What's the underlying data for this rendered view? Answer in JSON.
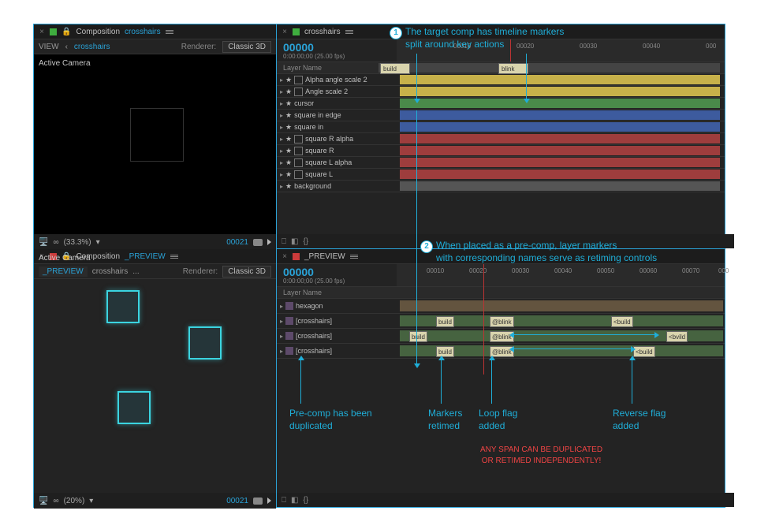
{
  "annotations": {
    "a1": "The target comp has timeline markers\nsplit around key actions",
    "a2": "When placed as a pre-comp, layer markers\nwith corresponding names serve as retiming controls",
    "b1": "Pre-comp has been\nduplicated",
    "b2": "Markers\nretimed",
    "b3": "Loop flag\nadded",
    "b4": "Reverse flag\nadded",
    "warn": "ANY SPAN CAN BE DUPLICATED\nOR RETIMED INDEPENDENTLY!"
  },
  "viewer1": {
    "compLabel": "Composition",
    "compName": "crosshairs",
    "navView": "VIEW",
    "navChevL": "‹",
    "active": "crosshairs",
    "renderer": "Renderer:",
    "rendermode": "Classic 3D",
    "activeCam": "Active Camera",
    "zoom": "(33.3%)",
    "frame": "00021"
  },
  "timeline1": {
    "name": "crosshairs",
    "tc": "00000",
    "tcsub": "0:00:00;00 (25.00 fps)",
    "layerNameHdr": "Layer Name",
    "ruler": [
      "00010",
      "00020",
      "00030",
      "00040",
      "000"
    ],
    "markers": {
      "build": "build",
      "blink": "blink"
    },
    "layers": [
      {
        "name": "Alpha angle scale 2",
        "color": "yl",
        "star": true,
        "box": true
      },
      {
        "name": "Angle scale 2",
        "color": "yl",
        "star": true,
        "box": true
      },
      {
        "name": "cursor",
        "color": "gn",
        "star": true,
        "box": false
      },
      {
        "name": "square in edge",
        "color": "bl",
        "star": true,
        "box": false
      },
      {
        "name": "square in",
        "color": "bl",
        "star": true,
        "box": false
      },
      {
        "name": "square R alpha",
        "color": "rd",
        "star": true,
        "box": true
      },
      {
        "name": "square R",
        "color": "rd",
        "star": true,
        "box": true
      },
      {
        "name": "square L alpha",
        "color": "rd",
        "star": true,
        "box": true
      },
      {
        "name": "square L",
        "color": "rd",
        "star": true,
        "box": true
      },
      {
        "name": "background",
        "color": "gy",
        "star": true,
        "box": false
      }
    ]
  },
  "viewer2": {
    "compLabel": "Composition",
    "compName": "_PREVIEW",
    "tabs": [
      "_PREVIEW",
      "crosshairs",
      "..."
    ],
    "renderer": "Renderer:",
    "rendermode": "Classic 3D",
    "activeCam": "Active Camera",
    "zoom": "(20%)",
    "frame": "00021"
  },
  "timeline2": {
    "name": "_PREVIEW",
    "tc": "00000",
    "tcsub": "0:00:00;00 (25.00 fps)",
    "layerNameHdr": "Layer Name",
    "ruler": [
      "00010",
      "00020",
      "00030",
      "00040",
      "00050",
      "00060",
      "00070",
      "000"
    ],
    "layers": [
      "hexagon",
      "[crosshairs]",
      "[crosshairs]",
      "[crosshairs]"
    ],
    "mkLabels": {
      "build": "build",
      "atblink": "@blink",
      "ltbuild": "<build",
      "ltbld": "<bvild"
    }
  }
}
